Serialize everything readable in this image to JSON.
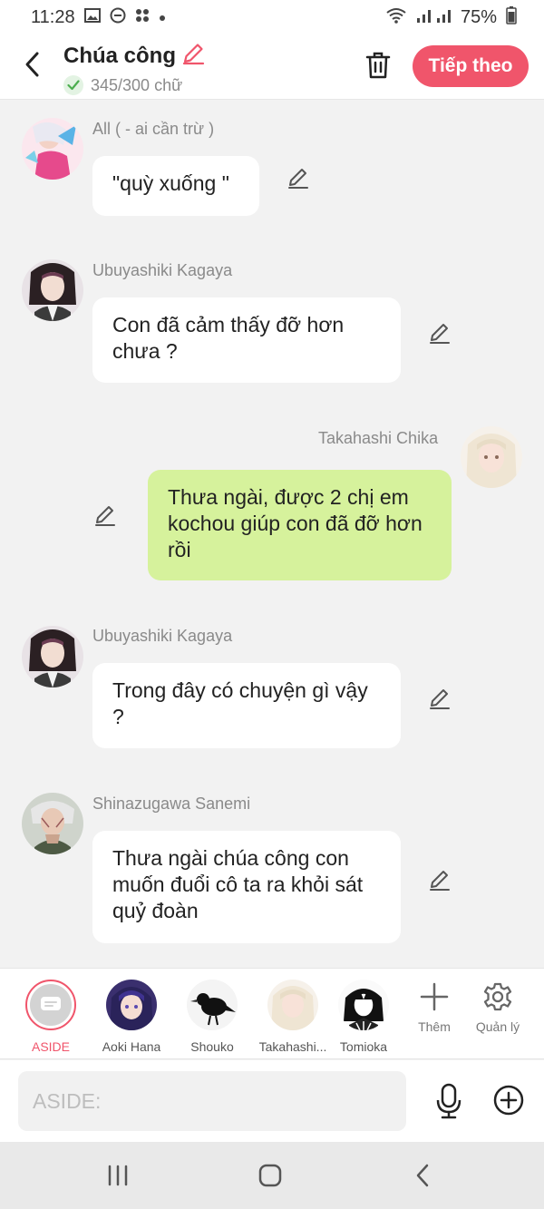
{
  "status_bar": {
    "time": "11:28",
    "battery": "75%"
  },
  "header": {
    "title": "Chúa công",
    "word_count": "345/300 chữ",
    "next_label": "Tiếp theo"
  },
  "messages": [
    {
      "name": "All ( - ai cần trừ )",
      "text": "\"quỳ xuống \""
    },
    {
      "name": "Ubuyashiki Kagaya",
      "text": "Con đã cảm thấy đỡ hơn chưa ?"
    },
    {
      "name": "Takahashi Chika",
      "text": "Thưa ngài, được 2 chị em kochou giúp con đã đỡ hơn rồi"
    },
    {
      "name": "Ubuyashiki Kagaya",
      "text": "Trong đây có chuyện gì vậy ?"
    },
    {
      "name": "Shinazugawa Sanemi",
      "text": "Thưa ngài chúa công con muốn đuổi cô ta ra khỏi sát quỷ đoàn"
    }
  ],
  "characters": [
    {
      "label": "ASIDE",
      "active": true
    },
    {
      "label": "Aoki Hana"
    },
    {
      "label": "Shouko"
    },
    {
      "label": "Takahashi..."
    },
    {
      "label": "Tomioka"
    }
  ],
  "tools": {
    "more_label": "Thêm",
    "manage_label": "Quản lý"
  },
  "input": {
    "placeholder": "ASIDE:"
  },
  "colors": {
    "accent": "#f0556b",
    "green_bubble": "#d6f29c",
    "background": "#f2f2f2"
  }
}
